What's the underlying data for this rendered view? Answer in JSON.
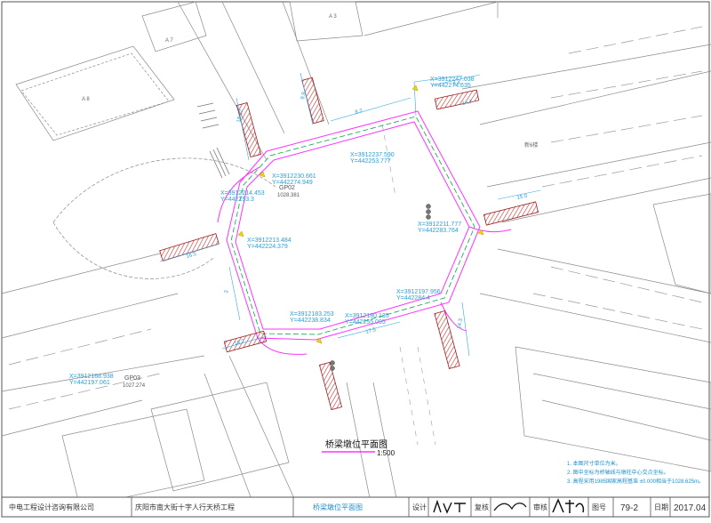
{
  "drawing": {
    "title": "桥梁墩位平面图",
    "scale": "1:500"
  },
  "buildings": [
    "A 8",
    "A 7",
    "A 3",
    "新6楼"
  ],
  "control_points": [
    {
      "name": "GP02",
      "elevation": "1028.381"
    },
    {
      "name": "GP03",
      "elevation": "1027.274"
    }
  ],
  "coordinates": [
    {
      "x": "X=3912247.038",
      "y": "Y=442274.635"
    },
    {
      "x": "X=3912237.590",
      "y": "Y=442253.777"
    },
    {
      "x": "X=3912230.661",
      "y": "Y=442274.949"
    },
    {
      "x": "X=3912214.453",
      "y": "Y=442253.3"
    },
    {
      "x": "X=3912213.484",
      "y": "Y=442224.379"
    },
    {
      "x": "X=3912211.777",
      "y": "Y=442283.764"
    },
    {
      "x": "X=3912197.956",
      "y": "Y=442284.4"
    },
    {
      "x": "X=3912183.253",
      "y": "Y=442238.834"
    },
    {
      "x": "X=3912180.135",
      "y": "Y=442255.095"
    },
    {
      "x": "X=3912168.938",
      "y": "Y=442197.061"
    }
  ],
  "dimension_labels": [
    "18.12",
    "9.9",
    "8.2",
    "8.4",
    "15.0",
    "16.5",
    "3",
    "14.3",
    "17.5",
    "16.2",
    "14.7"
  ],
  "notes": [
    "1. 本图尺寸单位为米。",
    "2. 图中坐标为桥轴线与墩柱中心交点坐标。",
    "3. 高程采用1985国家高程基准 ±0.000相当于1028.625m。"
  ],
  "title_block": {
    "company": "中电工程设计咨询有限公司",
    "project": "庆阳市南大街十字人行天桥工程",
    "drawing_name": "桥梁墩位平面图",
    "design_label": "设计",
    "review_label": "复核",
    "audit_label": "审核",
    "sheet_label": "图号",
    "sheet_number": "79-2",
    "date_label": "日期",
    "date": "2017.04"
  },
  "colors": {
    "bridge": "#ff33ff",
    "centerline": "#00aa44",
    "dimension": "#33a6e0",
    "pier": "#9b1e1e",
    "base": "#6a6a6a"
  }
}
